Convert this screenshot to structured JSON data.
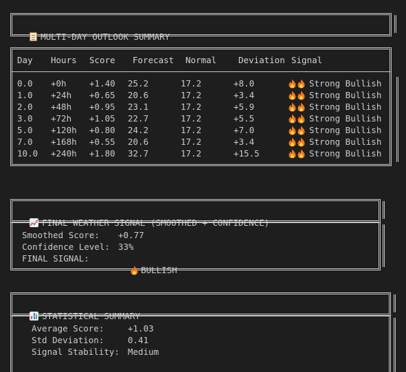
{
  "outlook": {
    "title": "MULTI-DAY OUTLOOK SUMMARY",
    "title_icon": "clipboard-icon",
    "headers": [
      "Day",
      "Hours",
      "Score",
      "Forecast",
      "Normal",
      "Deviation",
      "Signal"
    ],
    "rows": [
      {
        "day": "0.0",
        "hours": "+0h",
        "score": "+1.40",
        "forecast": "25.2",
        "normal": "17.2",
        "deviation": "+8.0",
        "signal": "Strong Bullish"
      },
      {
        "day": "1.0",
        "hours": "+24h",
        "score": "+0.65",
        "forecast": "20.6",
        "normal": "17.2",
        "deviation": "+3.4",
        "signal": "Strong Bullish"
      },
      {
        "day": "2.0",
        "hours": "+48h",
        "score": "+0.95",
        "forecast": "23.1",
        "normal": "17.2",
        "deviation": "+5.9",
        "signal": "Strong Bullish"
      },
      {
        "day": "3.0",
        "hours": "+72h",
        "score": "+1.05",
        "forecast": "22.7",
        "normal": "17.2",
        "deviation": "+5.5",
        "signal": "Strong Bullish"
      },
      {
        "day": "5.0",
        "hours": "+120h",
        "score": "+0.80",
        "forecast": "24.2",
        "normal": "17.2",
        "deviation": "+7.0",
        "signal": "Strong Bullish"
      },
      {
        "day": "7.0",
        "hours": "+168h",
        "score": "+0.55",
        "forecast": "20.6",
        "normal": "17.2",
        "deviation": "+3.4",
        "signal": "Strong Bullish"
      },
      {
        "day": "10.0",
        "hours": "+240h",
        "score": "+1.80",
        "forecast": "32.7",
        "normal": "17.2",
        "deviation": "+15.5",
        "signal": "Strong Bullish"
      }
    ]
  },
  "final": {
    "title": "FINAL WEATHER SIGNAL (SMOOTHED + CONFIDENCE)",
    "title_icon": "trend-chart-icon",
    "smoothed_label": "Smoothed Score:",
    "smoothed_value": "+0.77",
    "confidence_label": "Confidence Level:",
    "confidence_value": "33%",
    "signal_label": "FINAL SIGNAL:",
    "signal_value": "BULLISH"
  },
  "stats": {
    "title": "STATISTICAL SUMMARY",
    "title_icon": "bar-chart-icon",
    "avg_label": "Average Score:",
    "avg_value": "+1.03",
    "std_label": "Std Deviation:",
    "std_value": "0.41",
    "stability_label": "Signal Stability:",
    "stability_value": "Medium"
  },
  "colors": {
    "background": "#1e1e1e",
    "text": "#cccccc",
    "border": "#c8c8c8",
    "fire": "#f07a1a"
  }
}
